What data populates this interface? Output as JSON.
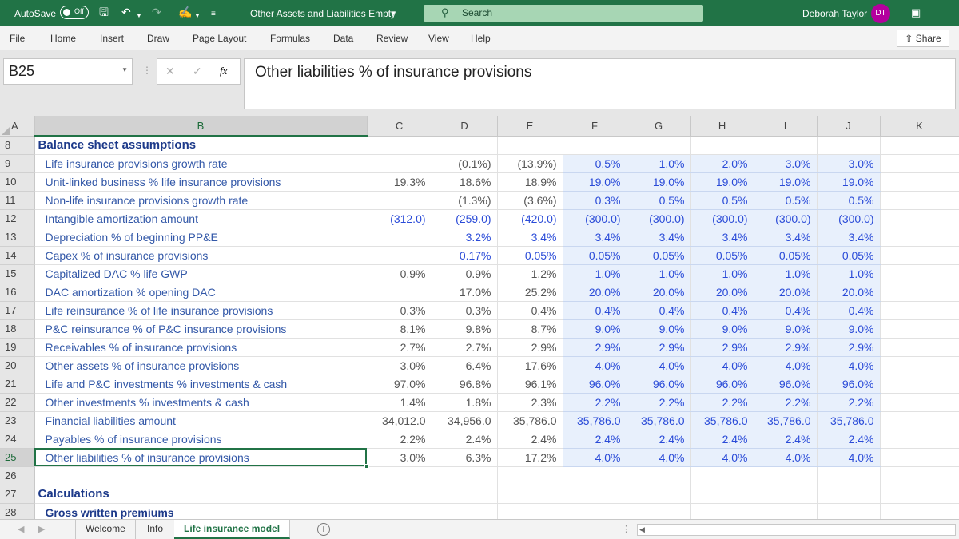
{
  "titlebar": {
    "autosave_label": "AutoSave",
    "autosave_state": "Off",
    "doc_title": "Other Assets and Liabilities Empty",
    "search_placeholder": "Search",
    "user_name": "Deborah Taylor",
    "user_initials": "DT"
  },
  "ribbon": {
    "tabs": [
      "File",
      "Home",
      "Insert",
      "Draw",
      "Page Layout",
      "Formulas",
      "Data",
      "Review",
      "View",
      "Help"
    ],
    "share_label": "Share"
  },
  "formula_bar": {
    "name_box": "B25",
    "fx_label": "fx",
    "content": "Other liabilities % of insurance provisions"
  },
  "columns": [
    "A",
    "B",
    "C",
    "D",
    "E",
    "F",
    "G",
    "H",
    "I",
    "J",
    "K"
  ],
  "rows": [
    {
      "n": "8",
      "label": "Balance sheet assumptions",
      "kind": "hdr",
      "values": [
        "",
        "",
        "",
        "",
        "",
        "",
        "",
        ""
      ]
    },
    {
      "n": "9",
      "label": "Life insurance provisions growth rate",
      "kind": "label",
      "values": [
        "",
        "(0.1%)",
        "(13.9%)",
        "0.5%",
        "1.0%",
        "2.0%",
        "3.0%",
        "3.0%"
      ]
    },
    {
      "n": "10",
      "label": "Unit-linked business % life insurance provisions",
      "kind": "label",
      "values": [
        "19.3%",
        "18.6%",
        "18.9%",
        "19.0%",
        "19.0%",
        "19.0%",
        "19.0%",
        "19.0%"
      ]
    },
    {
      "n": "11",
      "label": "Non-life insurance provisions growth rate",
      "kind": "label",
      "values": [
        "",
        "(1.3%)",
        "(3.6%)",
        "0.3%",
        "0.5%",
        "0.5%",
        "0.5%",
        "0.5%"
      ]
    },
    {
      "n": "12",
      "label": "Intangible amortization amount",
      "kind": "label",
      "blue": true,
      "values": [
        "(312.0)",
        "(259.0)",
        "(420.0)",
        "(300.0)",
        "(300.0)",
        "(300.0)",
        "(300.0)",
        "(300.0)"
      ]
    },
    {
      "n": "13",
      "label": "Depreciation % of beginning PP&E",
      "kind": "label",
      "blue": true,
      "values": [
        "",
        "3.2%",
        "3.4%",
        "3.4%",
        "3.4%",
        "3.4%",
        "3.4%",
        "3.4%"
      ]
    },
    {
      "n": "14",
      "label": "Capex % of insurance provisions",
      "kind": "label",
      "blue": true,
      "values": [
        "",
        "0.17%",
        "0.05%",
        "0.05%",
        "0.05%",
        "0.05%",
        "0.05%",
        "0.05%"
      ]
    },
    {
      "n": "15",
      "label": "Capitalized DAC % life GWP",
      "kind": "label",
      "values": [
        "0.9%",
        "0.9%",
        "1.2%",
        "1.0%",
        "1.0%",
        "1.0%",
        "1.0%",
        "1.0%"
      ]
    },
    {
      "n": "16",
      "label": "DAC amortization % opening DAC",
      "kind": "label",
      "values": [
        "",
        "17.0%",
        "25.2%",
        "20.0%",
        "20.0%",
        "20.0%",
        "20.0%",
        "20.0%"
      ]
    },
    {
      "n": "17",
      "label": "Life reinsurance % of life insurance provisions",
      "kind": "label",
      "values": [
        "0.3%",
        "0.3%",
        "0.4%",
        "0.4%",
        "0.4%",
        "0.4%",
        "0.4%",
        "0.4%"
      ]
    },
    {
      "n": "18",
      "label": "P&C reinsurance % of P&C insurance provisions",
      "kind": "label",
      "values": [
        "8.1%",
        "9.8%",
        "8.7%",
        "9.0%",
        "9.0%",
        "9.0%",
        "9.0%",
        "9.0%"
      ]
    },
    {
      "n": "19",
      "label": "Receivables % of insurance provisions",
      "kind": "label",
      "values": [
        "2.7%",
        "2.7%",
        "2.9%",
        "2.9%",
        "2.9%",
        "2.9%",
        "2.9%",
        "2.9%"
      ]
    },
    {
      "n": "20",
      "label": "Other assets % of insurance provisions",
      "kind": "label",
      "values": [
        "3.0%",
        "6.4%",
        "17.6%",
        "4.0%",
        "4.0%",
        "4.0%",
        "4.0%",
        "4.0%"
      ]
    },
    {
      "n": "21",
      "label": "Life and P&C investments % investments & cash",
      "kind": "label",
      "values": [
        "97.0%",
        "96.8%",
        "96.1%",
        "96.0%",
        "96.0%",
        "96.0%",
        "96.0%",
        "96.0%"
      ]
    },
    {
      "n": "22",
      "label": "Other investments % investments & cash",
      "kind": "label",
      "values": [
        "1.4%",
        "1.8%",
        "2.3%",
        "2.2%",
        "2.2%",
        "2.2%",
        "2.2%",
        "2.2%"
      ]
    },
    {
      "n": "23",
      "label": "Financial liabilities amount",
      "kind": "label",
      "values": [
        "34,012.0",
        "34,956.0",
        "35,786.0",
        "35,786.0",
        "35,786.0",
        "35,786.0",
        "35,786.0",
        "35,786.0"
      ]
    },
    {
      "n": "24",
      "label": "Payables % of insurance provisions",
      "kind": "label",
      "values": [
        "2.2%",
        "2.4%",
        "2.4%",
        "2.4%",
        "2.4%",
        "2.4%",
        "2.4%",
        "2.4%"
      ]
    },
    {
      "n": "25",
      "label": "Other liabilities % of insurance provisions",
      "kind": "label",
      "selected": true,
      "values": [
        "3.0%",
        "6.3%",
        "17.2%",
        "4.0%",
        "4.0%",
        "4.0%",
        "4.0%",
        "4.0%"
      ]
    },
    {
      "n": "26",
      "label": "",
      "kind": "empty",
      "values": [
        "",
        "",
        "",
        "",
        "",
        "",
        "",
        ""
      ]
    },
    {
      "n": "27",
      "label": "Calculations",
      "kind": "hdr",
      "values": [
        "",
        "",
        "",
        "",
        "",
        "",
        "",
        ""
      ]
    },
    {
      "n": "28",
      "label": "Gross written premiums",
      "kind": "sub",
      "values": [
        "",
        "",
        "",
        "",
        "",
        "",
        "",
        ""
      ]
    }
  ],
  "sheet_tabs": [
    {
      "label": "Welcome",
      "active": false
    },
    {
      "label": "Info",
      "active": false
    },
    {
      "label": "Life insurance model",
      "active": true
    }
  ],
  "colors": {
    "excel_green": "#217346",
    "input_blue": "#2a4bd8",
    "label_blue": "#3358a8",
    "forecast_fill": "#e8f0fc",
    "avatar": "#b4009e"
  }
}
